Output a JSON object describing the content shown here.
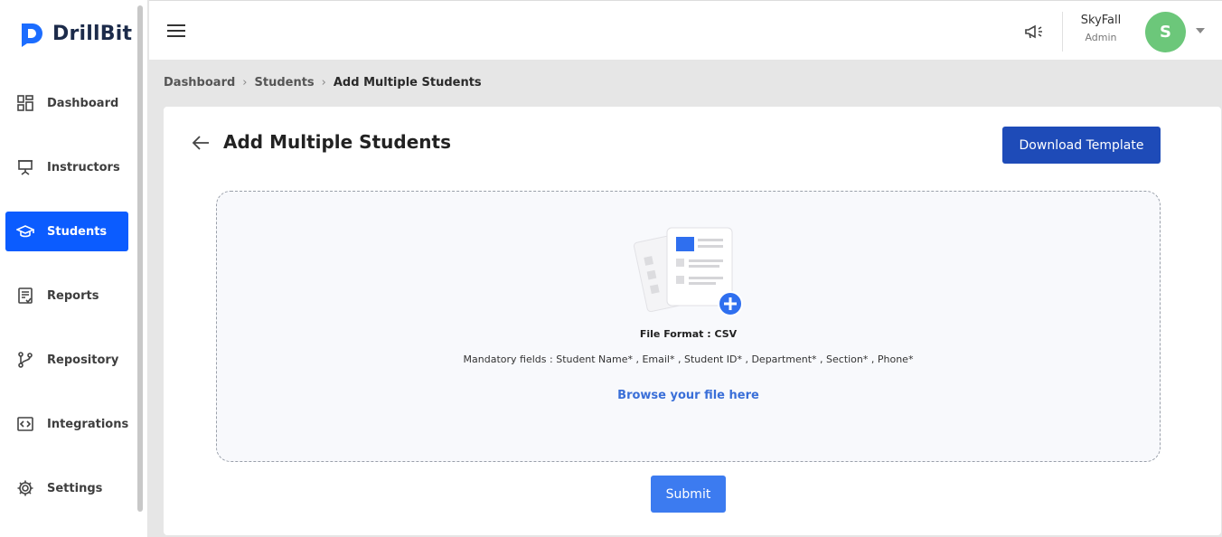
{
  "app": {
    "brand": "DrillBit"
  },
  "sidebar": {
    "items": [
      {
        "label": "Dashboard",
        "icon": "dashboard-icon"
      },
      {
        "label": "Instructors",
        "icon": "presentation-board-icon"
      },
      {
        "label": "Students",
        "icon": "graduation-cap-icon",
        "active": true
      },
      {
        "label": "Reports",
        "icon": "report-icon"
      },
      {
        "label": "Repository",
        "icon": "git-branch-icon"
      },
      {
        "label": "Integrations",
        "icon": "code-brackets-icon"
      },
      {
        "label": "Settings",
        "icon": "gear-icon"
      }
    ]
  },
  "header": {
    "user_name": "SkyFall",
    "user_role": "Admin",
    "avatar_initial": "S"
  },
  "breadcrumb": {
    "items": [
      "Dashboard",
      "Students",
      "Add Multiple Students"
    ]
  },
  "main": {
    "title": "Add Multiple Students",
    "download_label": "Download Template",
    "file_format": "File Format : CSV",
    "mandatory_fields": "Mandatory fields : Student Name* , Email* , Student ID* , Department* , Section* , Phone*",
    "browse_label": "Browse your file here",
    "submit_label": "Submit"
  },
  "colors": {
    "accent": "#0b5cff",
    "primary_button": "#1e4bb8",
    "submit_button": "#3c7bf0",
    "avatar": "#6cc77a",
    "link": "#3a6fd8"
  }
}
